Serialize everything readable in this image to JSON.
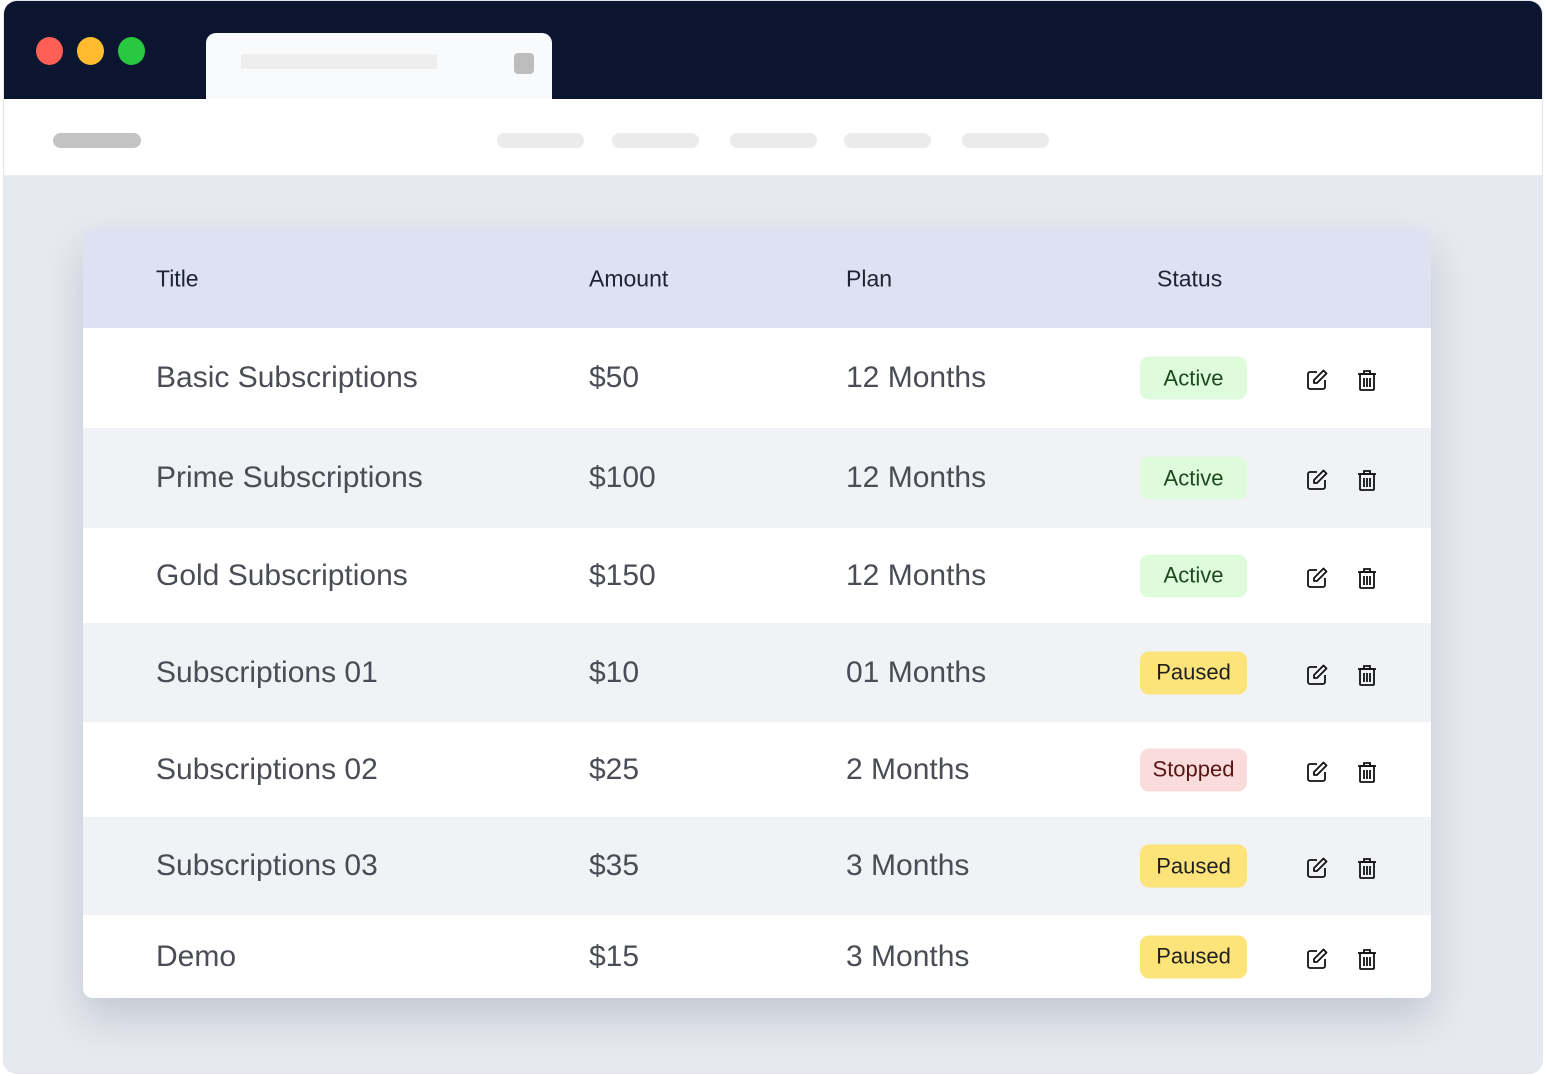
{
  "window": {
    "controls": {
      "close_color": "#fe5f57",
      "minimize_color": "#febc2e",
      "maximize_color": "#28c840"
    }
  },
  "table": {
    "headers": {
      "title": "Title",
      "amount": "Amount",
      "plan": "Plan",
      "status": "Status"
    },
    "rows": [
      {
        "title": "Basic Subscriptions",
        "amount": "$50",
        "plan": "12 Months",
        "status": "Active"
      },
      {
        "title": "Prime Subscriptions",
        "amount": "$100",
        "plan": "12 Months",
        "status": "Active"
      },
      {
        "title": "Gold Subscriptions",
        "amount": "$150",
        "plan": "12 Months",
        "status": "Active"
      },
      {
        "title": "Subscriptions 01",
        "amount": "$10",
        "plan": "01 Months",
        "status": "Paused"
      },
      {
        "title": "Subscriptions 02",
        "amount": "$25",
        "plan": "2 Months",
        "status": "Stopped"
      },
      {
        "title": "Subscriptions 03",
        "amount": "$35",
        "plan": "3 Months",
        "status": "Paused"
      },
      {
        "title": "Demo",
        "amount": "$15",
        "plan": "3 Months",
        "status": "Paused"
      }
    ],
    "status_colors": {
      "Active": {
        "bg": "#defbdc",
        "fg": "#1e4a1e"
      },
      "Paused": {
        "bg": "#fde47a",
        "fg": "#1f1f1f"
      },
      "Stopped": {
        "bg": "#fbdcdc",
        "fg": "#5a1515"
      }
    },
    "row_actions": [
      "edit-icon",
      "trash-icon"
    ]
  }
}
